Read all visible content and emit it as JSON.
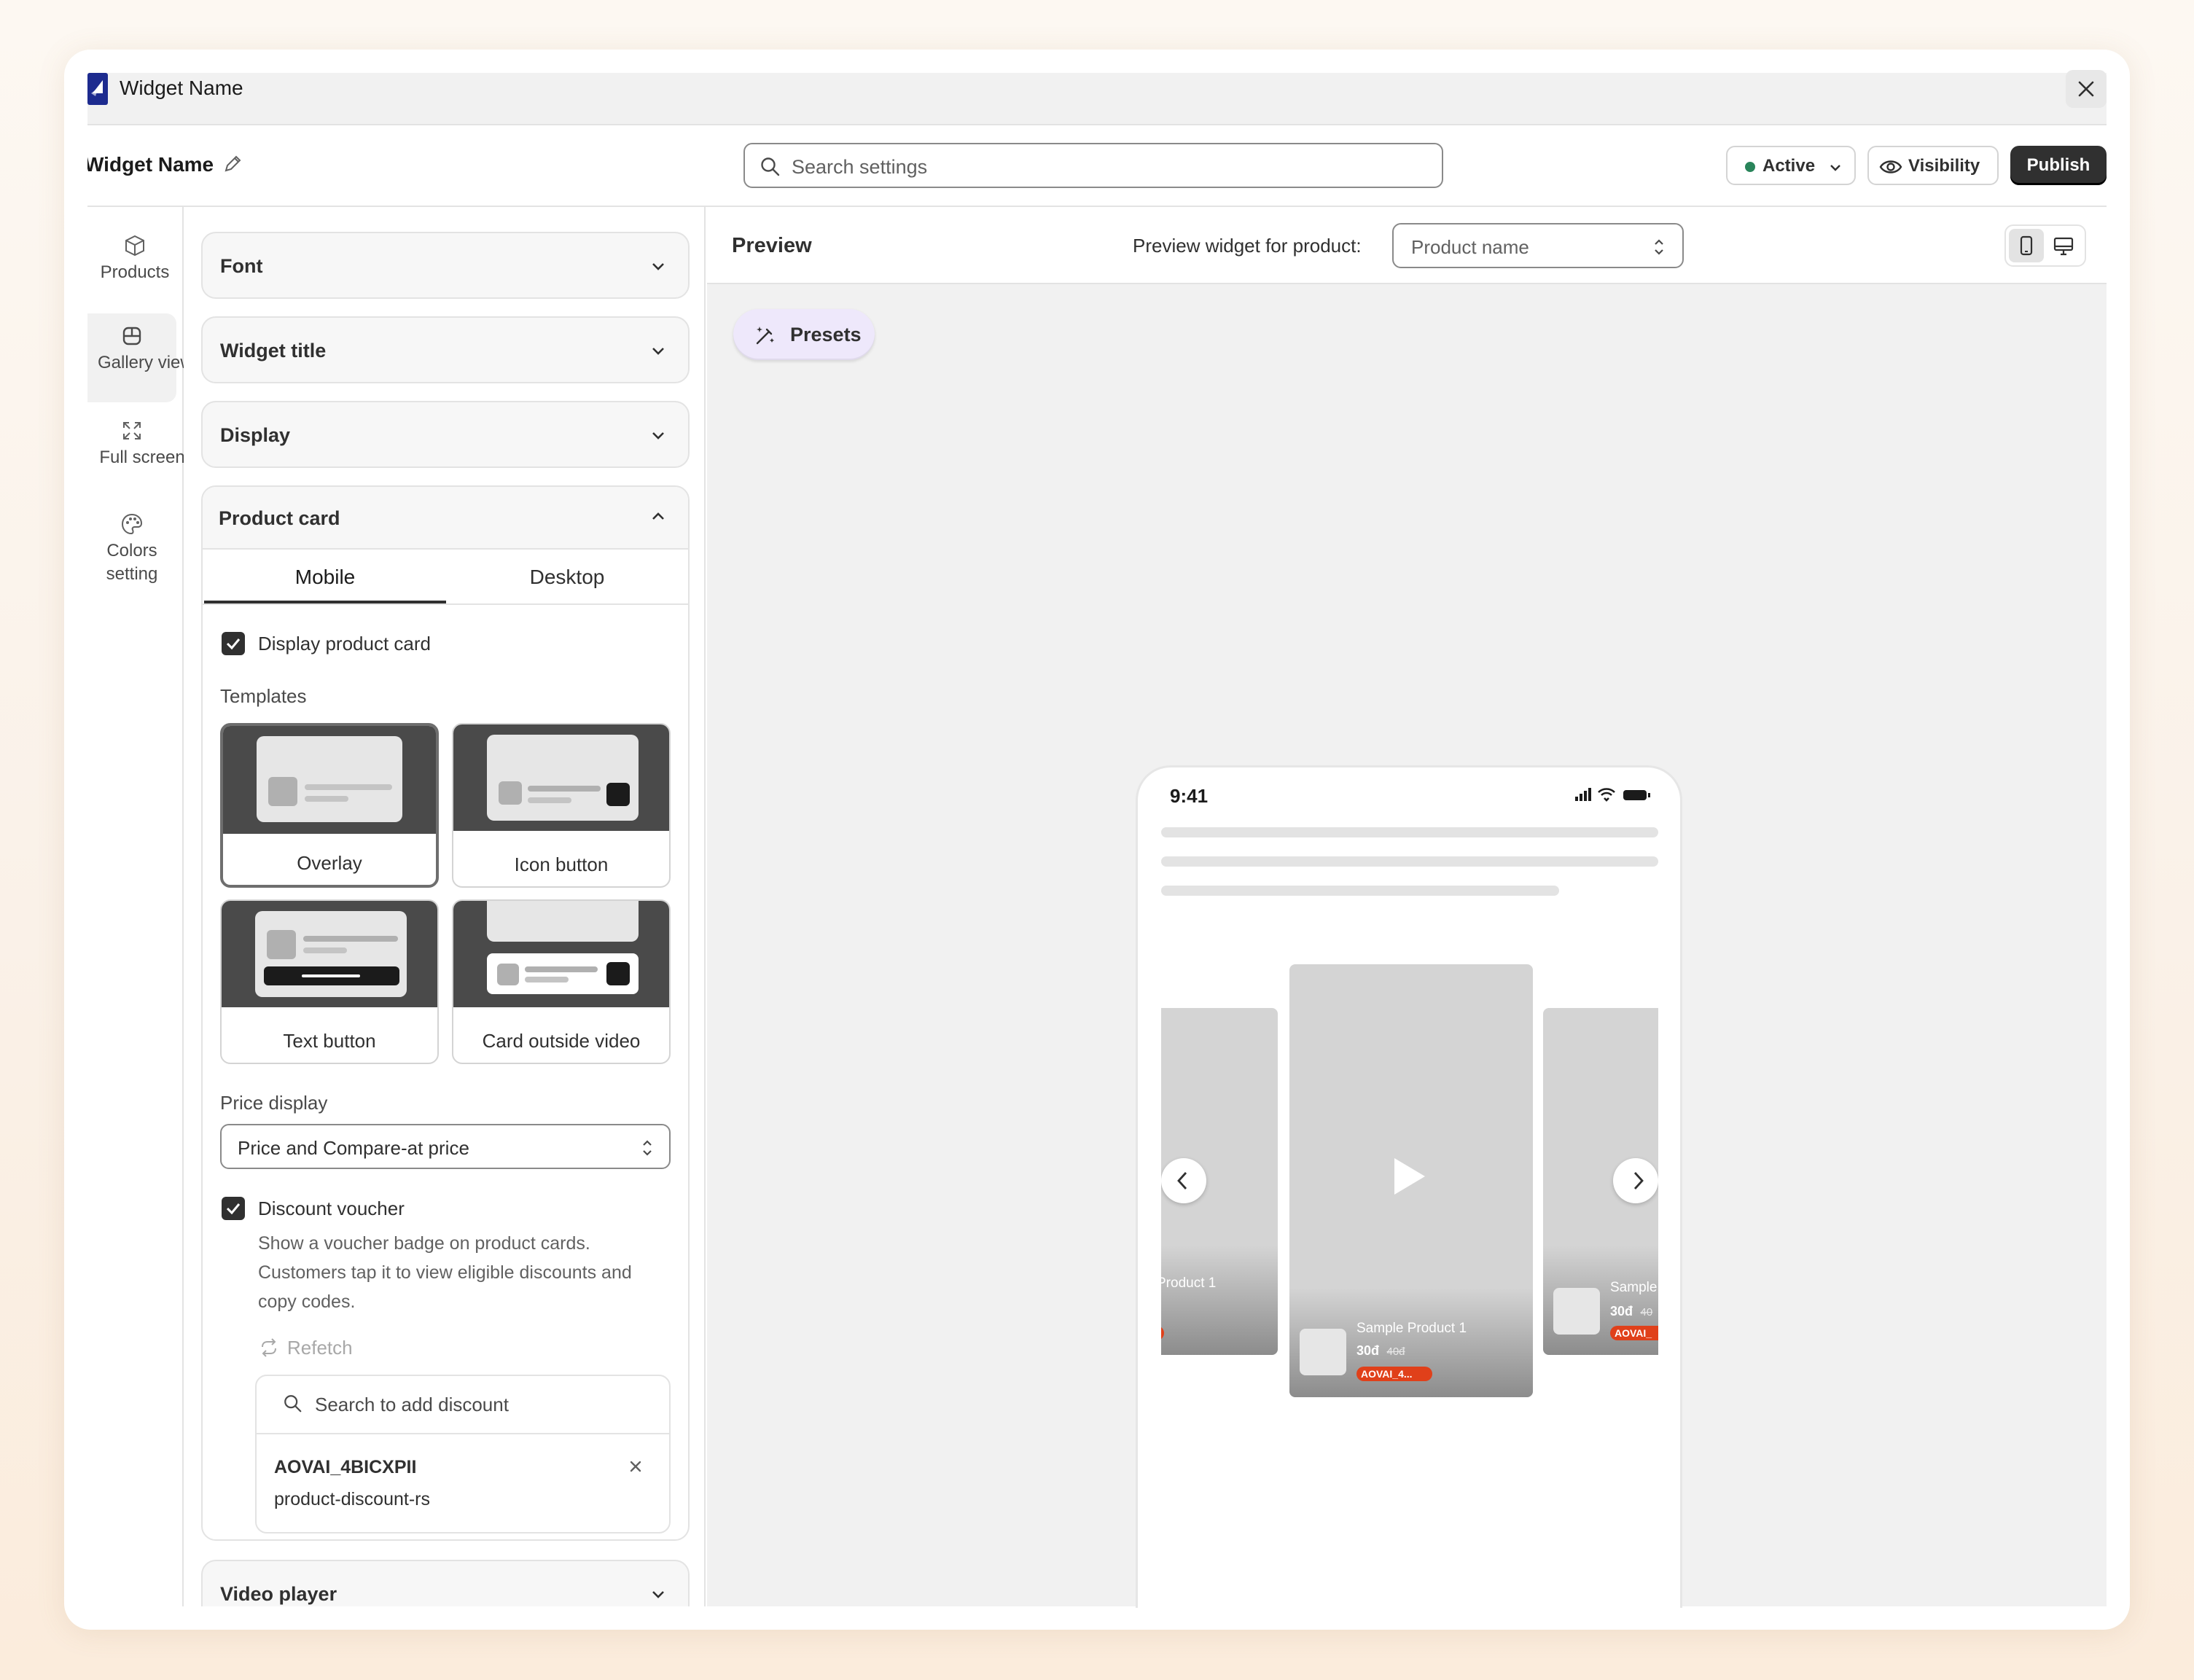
{
  "window": {
    "title": "Widget Name"
  },
  "topbar": {
    "widget_name": "Widget Name",
    "search_placeholder": "Search settings",
    "status_label": "Active",
    "visibility_label": "Visibility",
    "publish_label": "Publish"
  },
  "leftnav": {
    "items": [
      {
        "label": "Products",
        "icon": "cube-icon"
      },
      {
        "label": "Gallery view",
        "icon": "gallery-icon",
        "selected": true
      },
      {
        "label": "Full screen",
        "icon": "expand-icon"
      },
      {
        "label": "Colors setting",
        "icon": "palette-icon"
      }
    ]
  },
  "settings": {
    "sections": [
      "Font",
      "Widget title",
      "Display"
    ],
    "product_card": {
      "title": "Product card",
      "tabs": [
        "Mobile",
        "Desktop"
      ],
      "display_label": "Display product card",
      "display_checked": true,
      "templates_label": "Templates",
      "templates": [
        "Overlay",
        "Icon button",
        "Text button",
        "Card outside video"
      ],
      "selected_template": "Overlay",
      "price_display_label": "Price display",
      "price_display_value": "Price and Compare-at price",
      "discount_label": "Discount voucher",
      "discount_checked": true,
      "discount_help": "Show a voucher badge on product cards. Customers tap it to view eligible discounts and copy codes.",
      "refetch_label": "Refetch",
      "discount_search_placeholder": "Search to add discount",
      "discount_item": {
        "code": "AOVAI_4BICXPII",
        "handle": "product-discount-rs"
      }
    },
    "video_player": "Video player"
  },
  "preview": {
    "title": "Preview",
    "product_label": "Preview widget for product:",
    "product_placeholder": "Product name",
    "presets_label": "Presets",
    "phone": {
      "time": "9:41",
      "left_card_name": "Product 1",
      "center_card": {
        "name": "Sample Product 1",
        "price": "30đ",
        "compare": "40đ",
        "badge": "AOVAI_4..."
      },
      "right_card": {
        "name": "Sample",
        "price": "30đ",
        "compare": "40",
        "badge": "AOVAI_"
      }
    }
  },
  "colors": {
    "accent": "#303030",
    "active_dot": "#29845a",
    "badge": "#e0401a",
    "presets_bg": "#eee8fb"
  }
}
